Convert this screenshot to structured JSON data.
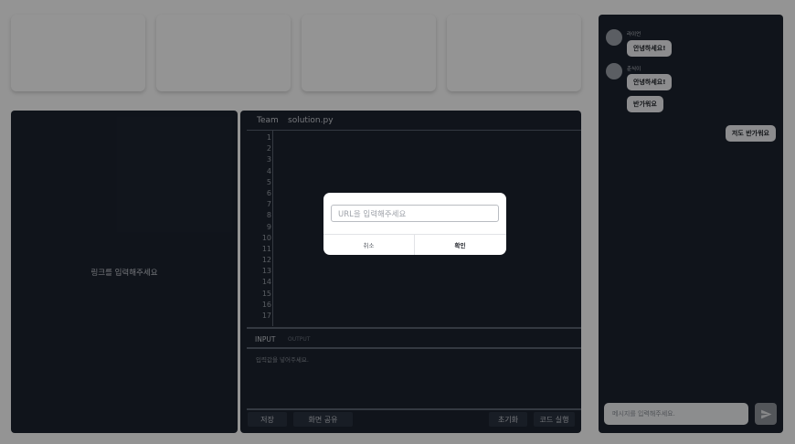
{
  "link_panel": {
    "placeholder": "링크를 입력해주세요"
  },
  "editor": {
    "team_label": "Team",
    "filename": "solution.py",
    "line_numbers": [
      "1",
      "2",
      "3",
      "4",
      "5",
      "6",
      "7",
      "8",
      "9",
      "10",
      "11",
      "12",
      "13",
      "14",
      "15",
      "16",
      "17"
    ],
    "tabs": {
      "input": "INPUT",
      "output": "OUTPUT"
    },
    "input_placeholder": "입력값을 넣어주세요.",
    "buttons": {
      "save": "저장",
      "share": "화면 공유",
      "reset": "초기화",
      "run": "코드 실행"
    }
  },
  "chat": {
    "messages": [
      {
        "sender": "라이언",
        "text": "안녕하세요!"
      },
      {
        "sender": "춘식이",
        "text": "안녕하세요!"
      },
      {
        "sender": "",
        "text": "반가워요"
      },
      {
        "sender": "",
        "text": "저도 반가워요"
      }
    ],
    "input_placeholder": "메시지를 입력해주세요.",
    "send_icon": "send-icon"
  },
  "modal": {
    "url_placeholder": "URL을 입력해주세요",
    "cancel_label": "취소",
    "confirm_label": "확인"
  },
  "colors": {
    "panel_bg": "#1d2430",
    "overlay": "rgba(0,0,0,0.42)"
  }
}
